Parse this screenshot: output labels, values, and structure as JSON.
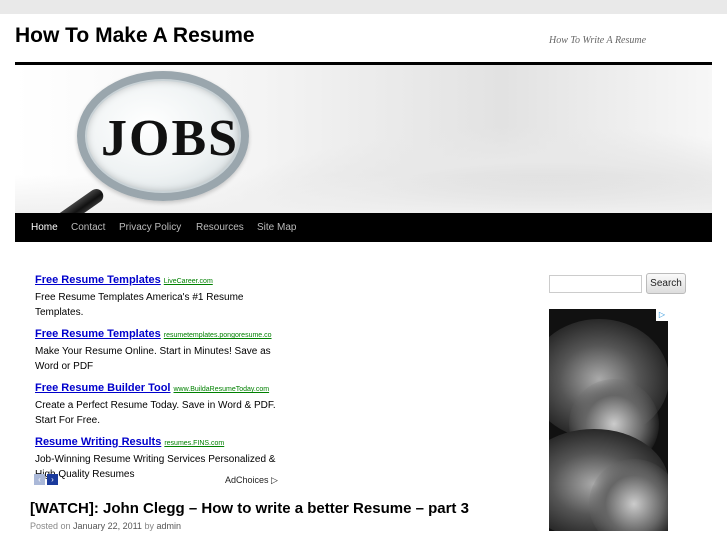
{
  "header": {
    "site_title": "How To Make A Resume",
    "tagline": "How To Write A Resume"
  },
  "banner": {
    "text": "JOBS"
  },
  "nav": {
    "items": [
      {
        "label": "Home",
        "active": true
      },
      {
        "label": "Contact",
        "active": false
      },
      {
        "label": "Privacy Policy",
        "active": false
      },
      {
        "label": "Resources",
        "active": false
      },
      {
        "label": "Site Map",
        "active": false
      }
    ]
  },
  "ads": [
    {
      "title": "Free Resume Templates",
      "url": "LiveCareer.com",
      "desc": "Free Resume Templates America's #1 Resume Templates."
    },
    {
      "title": "Free Resume Templates",
      "url": "resumetemplates.pongoresume.co",
      "desc": "Make Your Resume Online. Start in Minutes! Save as Word or PDF"
    },
    {
      "title": "Free Resume Builder Tool",
      "url": "www.BuildaResumeToday.com",
      "desc": "Create a Perfect Resume Today. Save in Word & PDF. Start For Free."
    },
    {
      "title": "Resume Writing Results",
      "url": "resumes.FINS.com",
      "desc": "Job-Winning Resume Writing Services Personalized & High Quality Resumes"
    }
  ],
  "ad_controls": {
    "prev": "‹",
    "next": "›",
    "adchoices": "AdChoices ▷"
  },
  "post": {
    "title": "[WATCH]: John Clegg – How to write a better Resume – part 3",
    "meta_prefix": "Posted on",
    "date": "January 22, 2011",
    "meta_by": "by",
    "author": "admin"
  },
  "sidebar": {
    "search_placeholder": "",
    "search_button": "Search",
    "ad_badge": "▷"
  },
  "colors": {
    "nav_bg": "#000000",
    "ad_link": "#0000cc",
    "ad_url": "#008000"
  }
}
